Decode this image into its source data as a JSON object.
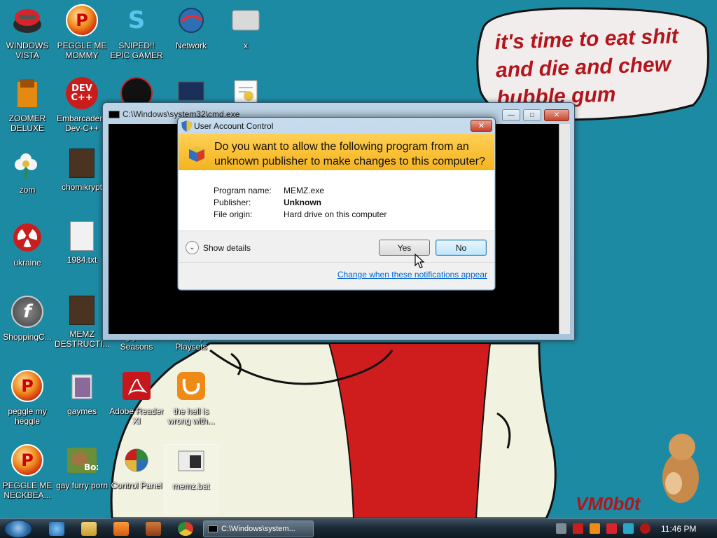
{
  "wallpaper": {
    "bubble_text": "it's time to eat shit and die and chew bubble gum",
    "signature": "VM0b0t"
  },
  "desktop_icons": [
    {
      "label": "WINDOWS VISTA",
      "icon": "windows-vista-icon"
    },
    {
      "label": "PEGGLE ME MOMMY",
      "icon": "peggle-icon"
    },
    {
      "label": "SNIPED!! EPIC GAMER 360...",
      "icon": "skype-icon"
    },
    {
      "label": "Network",
      "icon": "network-icon"
    },
    {
      "label": "x",
      "icon": "drive-icon"
    },
    {
      "label": "ZOOMER DELUXE",
      "icon": "zoomer-icon"
    },
    {
      "label": "Embarcadero Dev-C++",
      "icon": "devcpp-icon"
    },
    {
      "label": "zom",
      "icon": "flower-icon"
    },
    {
      "label": "chomikrypt",
      "icon": "archive-icon"
    },
    {
      "label": "ukraine",
      "icon": "radiation-icon"
    },
    {
      "label": "1984.txt",
      "icon": "text-file-icon"
    },
    {
      "label": "ShoppingC...",
      "icon": "flash-icon"
    },
    {
      "label": "MEMZ DESTRUCTI...",
      "icon": "archive-icon"
    },
    {
      "label": "Angry Birds Seasons",
      "icon": "angry-birds-icon"
    },
    {
      "label": "Scoptoys Playsets",
      "icon": "toys-icon"
    },
    {
      "label": "peggle my heggle",
      "icon": "peggle-icon"
    },
    {
      "label": "gaymes",
      "icon": "folder-icon"
    },
    {
      "label": "Adobe Reader XI",
      "icon": "adobe-reader-icon"
    },
    {
      "label": "the hell is wrong with...",
      "icon": "uc-browser-icon"
    },
    {
      "label": "PEGGLE ME NECKBEA...",
      "icon": "peggle-icon"
    },
    {
      "label": "gay furry porn",
      "icon": "game-box-icon"
    },
    {
      "label": "Control Panel",
      "icon": "control-panel-icon"
    },
    {
      "label": "memz.bat",
      "icon": "batch-file-icon"
    }
  ],
  "cmd_window": {
    "title": "C:\\Windows\\system32\\cmd.exe",
    "min_glyph": "—",
    "max_glyph": "□",
    "close_glyph": "✕"
  },
  "uac": {
    "title": "User Account Control",
    "question": "Do you want to allow the following program from an unknown publisher to make changes to this computer?",
    "program_name_label": "Program name:",
    "program_name": "MEMZ.exe",
    "publisher_label": "Publisher:",
    "publisher": "Unknown",
    "file_origin_label": "File origin:",
    "file_origin": "Hard drive on this computer",
    "show_details": "Show details",
    "yes": "Yes",
    "no": "No",
    "notifications_link": "Change when these notifications appear",
    "close_glyph": "✕",
    "chevron_glyph": "⌄"
  },
  "taskbar": {
    "active_task": "C:\\Windows\\system...",
    "clock": "11:46 PM",
    "colors": {
      "accent": "#f4b41f",
      "link": "#0066cc"
    }
  }
}
